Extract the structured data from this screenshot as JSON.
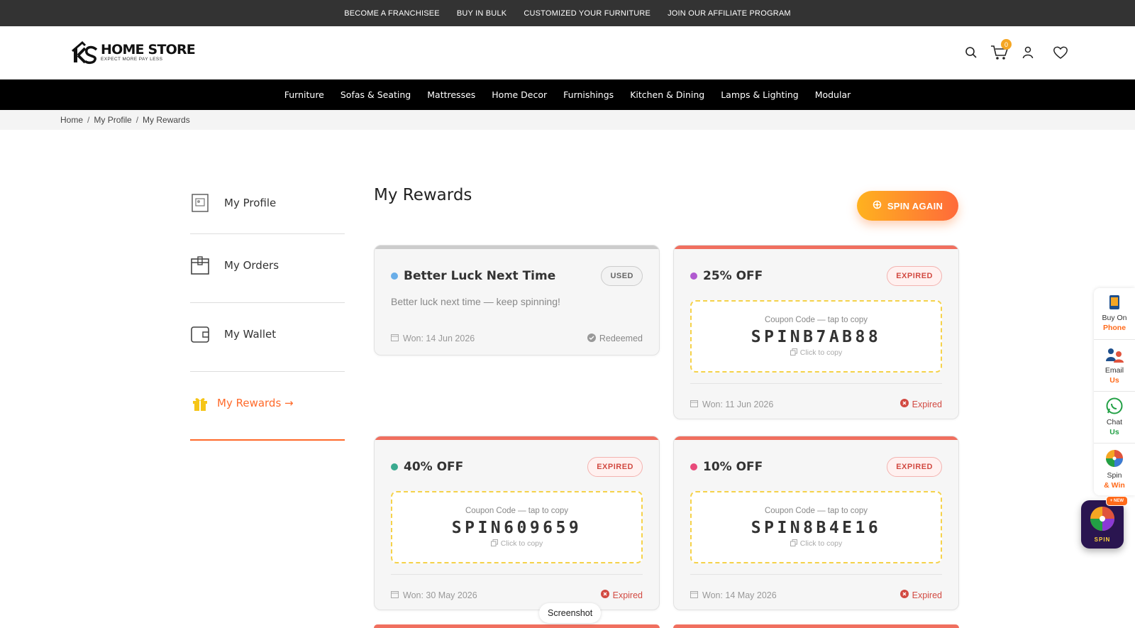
{
  "topbar": {
    "links": [
      "BECOME A FRANCHISEE",
      "BUY IN BULK",
      "CUSTOMIZED YOUR FURNITURE",
      "JOIN OUR AFFILIATE PROGRAM"
    ]
  },
  "header": {
    "logo_name": "HOME STORE",
    "logo_tagline": "EXPECT MORE PAY LESS",
    "cart_count": "0"
  },
  "nav": {
    "items": [
      "Furniture",
      "Sofas & Seating",
      "Mattresses",
      "Home Decor",
      "Furnishings",
      "Kitchen & Dining",
      "Lamps & Lighting",
      "Modular"
    ]
  },
  "breadcrumb": {
    "items": [
      "Home",
      "My Profile",
      "My Rewards"
    ],
    "separator": "/"
  },
  "sidebar": {
    "items": [
      {
        "label": "My Profile",
        "icon": "profile-card-icon"
      },
      {
        "label": "My Orders",
        "icon": "box-icon"
      },
      {
        "label": "My Wallet",
        "icon": "wallet-icon"
      },
      {
        "label": "My Rewards →",
        "icon": "gift-icon",
        "active": true
      }
    ]
  },
  "main": {
    "title": "My Rewards",
    "spin_again_label": "SPIN AGAIN"
  },
  "rewards": [
    {
      "title": "Better Luck Next Time",
      "dot_color": "#6aaee8",
      "status_pill": "USED",
      "description": "Better luck next time — keep spinning!",
      "won": "Won: 14 Jun 2026",
      "status": "Redeemed"
    },
    {
      "title": "25% OFF",
      "dot_color": "#b05ad0",
      "status_pill": "EXPIRED",
      "coupon_hint": "Coupon Code — tap to copy",
      "code": "SPINB7AB88",
      "copy_hint": "Click to copy",
      "won": "Won: 11 Jun 2026",
      "status": "Expired"
    },
    {
      "title": "40% OFF",
      "dot_color": "#3aaa8f",
      "status_pill": "EXPIRED",
      "coupon_hint": "Coupon Code — tap to copy",
      "code": "SPIN609659",
      "copy_hint": "Click to copy",
      "won": "Won: 30 May 2026",
      "status": "Expired"
    },
    {
      "title": "10% OFF",
      "dot_color": "#e84a7a",
      "status_pill": "EXPIRED",
      "coupon_hint": "Coupon Code — tap to copy",
      "code": "SPIN8B4E16",
      "copy_hint": "Click to copy",
      "won": "Won: 14 May 2026",
      "status": "Expired"
    }
  ],
  "float_panel": {
    "items": [
      {
        "line1": "Buy On",
        "line2": "Phone"
      },
      {
        "line1": "Email",
        "line2": "Us"
      },
      {
        "line1": "Chat",
        "line2": "Us"
      },
      {
        "line1": "Spin",
        "line2": "& Win"
      }
    ]
  },
  "spin_badge": {
    "new_label": "+ NEW",
    "label": "SPIN"
  },
  "tooltip": "Screenshot",
  "colors": {
    "accent": "#ff6a2a",
    "expired": "#d24a42",
    "coupon_border": "#f5d24a",
    "topbar": "#333333"
  }
}
